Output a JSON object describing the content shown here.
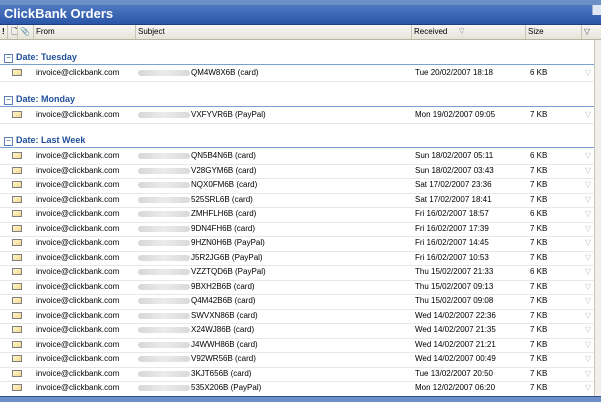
{
  "window": {
    "title": "ClickBank Orders"
  },
  "columns": {
    "importance_icon": "!",
    "type_icon": "🗋",
    "attach_icon": "📎",
    "from": "From",
    "subject": "Subject",
    "received": "Received",
    "size": "Size"
  },
  "icons": {
    "envelope": "envelope-icon",
    "flag": "flag-icon",
    "filter": "funnel-icon",
    "collapse": "minus-box-icon"
  },
  "groups": [
    {
      "label": "Date: Tuesday"
    },
    {
      "label": "Date: Monday"
    },
    {
      "label": "Date: Last Week"
    }
  ],
  "rows": [
    {
      "from": "invoice@clickbank.com",
      "subject": "QM4W8X6B (card)",
      "received": "Tue 20/02/2007 18:18",
      "size": "6 KB"
    },
    {
      "from": "invoice@clickbank.com",
      "subject": "VXFYVR6B (PayPal)",
      "received": "Mon 19/02/2007 09:05",
      "size": "7 KB"
    },
    {
      "from": "invoice@clickbank.com",
      "subject": "QN5B4N6B (card)",
      "received": "Sun 18/02/2007 05:11",
      "size": "6 KB"
    },
    {
      "from": "invoice@clickbank.com",
      "subject": "V28GYM6B (card)",
      "received": "Sun 18/02/2007 03:43",
      "size": "7 KB"
    },
    {
      "from": "invoice@clickbank.com",
      "subject": "NQX0FM6B (card)",
      "received": "Sat 17/02/2007 23:36",
      "size": "7 KB"
    },
    {
      "from": "invoice@clickbank.com",
      "subject": "525SRL6B (card)",
      "received": "Sat 17/02/2007 18:41",
      "size": "7 KB"
    },
    {
      "from": "invoice@clickbank.com",
      "subject": "ZMHFLH6B (card)",
      "received": "Fri 16/02/2007 18:57",
      "size": "6 KB"
    },
    {
      "from": "invoice@clickbank.com",
      "subject": "9DN4FH6B (card)",
      "received": "Fri 16/02/2007 17:39",
      "size": "7 KB"
    },
    {
      "from": "invoice@clickbank.com",
      "subject": "9HZN0H6B (PayPal)",
      "received": "Fri 16/02/2007 14:45",
      "size": "7 KB"
    },
    {
      "from": "invoice@clickbank.com",
      "subject": "J5R2JG6B (PayPal)",
      "received": "Fri 16/02/2007 10:53",
      "size": "7 KB"
    },
    {
      "from": "invoice@clickbank.com",
      "subject": "VZZTQD6B (PayPal)",
      "received": "Thu 15/02/2007 21:33",
      "size": "6 KB"
    },
    {
      "from": "invoice@clickbank.com",
      "subject": "9BXH2B6B (card)",
      "received": "Thu 15/02/2007 09:13",
      "size": "7 KB"
    },
    {
      "from": "invoice@clickbank.com",
      "subject": "Q4M42B6B (card)",
      "received": "Thu 15/02/2007 09:08",
      "size": "7 KB"
    },
    {
      "from": "invoice@clickbank.com",
      "subject": "SWVXN86B (card)",
      "received": "Wed 14/02/2007 22:36",
      "size": "7 KB"
    },
    {
      "from": "invoice@clickbank.com",
      "subject": "X24WJ86B (card)",
      "received": "Wed 14/02/2007 21:35",
      "size": "7 KB"
    },
    {
      "from": "invoice@clickbank.com",
      "subject": "J4WWH86B (card)",
      "received": "Wed 14/02/2007 21:21",
      "size": "7 KB"
    },
    {
      "from": "invoice@clickbank.com",
      "subject": "V92WR56B (card)",
      "received": "Wed 14/02/2007 00:49",
      "size": "7 KB"
    },
    {
      "from": "invoice@clickbank.com",
      "subject": "3KJT656B (card)",
      "received": "Tue 13/02/2007 20:50",
      "size": "7 KB"
    },
    {
      "from": "invoice@clickbank.com",
      "subject": "535X206B (PayPal)",
      "received": "Mon 12/02/2007 06:20",
      "size": "7 KB"
    }
  ]
}
